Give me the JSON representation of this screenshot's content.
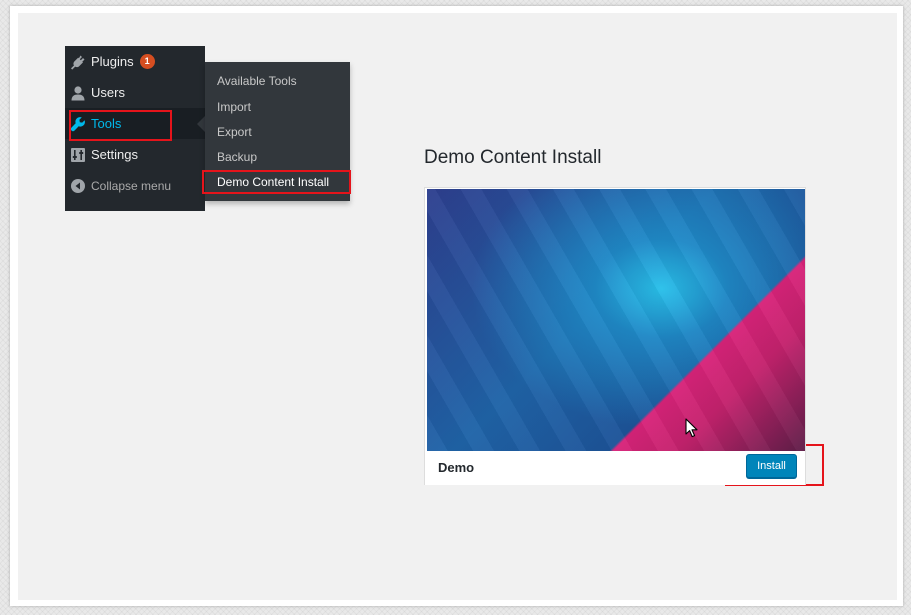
{
  "sidebar": {
    "items": [
      {
        "label": "Plugins",
        "icon": "plug-icon",
        "badge": "1"
      },
      {
        "label": "Users",
        "icon": "user-icon"
      },
      {
        "label": "Tools",
        "icon": "wrench-icon",
        "active": true
      },
      {
        "label": "Settings",
        "icon": "settings-icon"
      },
      {
        "label": "Collapse menu",
        "icon": "collapse-icon"
      }
    ]
  },
  "submenu": {
    "items": [
      {
        "label": "Available Tools"
      },
      {
        "label": "Import"
      },
      {
        "label": "Export"
      },
      {
        "label": "Backup"
      },
      {
        "label": "Demo Content Install",
        "current": true
      }
    ]
  },
  "page": {
    "title": "Demo Content Install"
  },
  "demo": {
    "name": "Demo",
    "install_label": "Install"
  },
  "colors": {
    "sidebar_bg": "#23282d",
    "submenu_bg": "#32373c",
    "active_text": "#00b9eb",
    "badge": "#d54e21",
    "button": "#0085ba",
    "highlight": "#e5141b"
  }
}
